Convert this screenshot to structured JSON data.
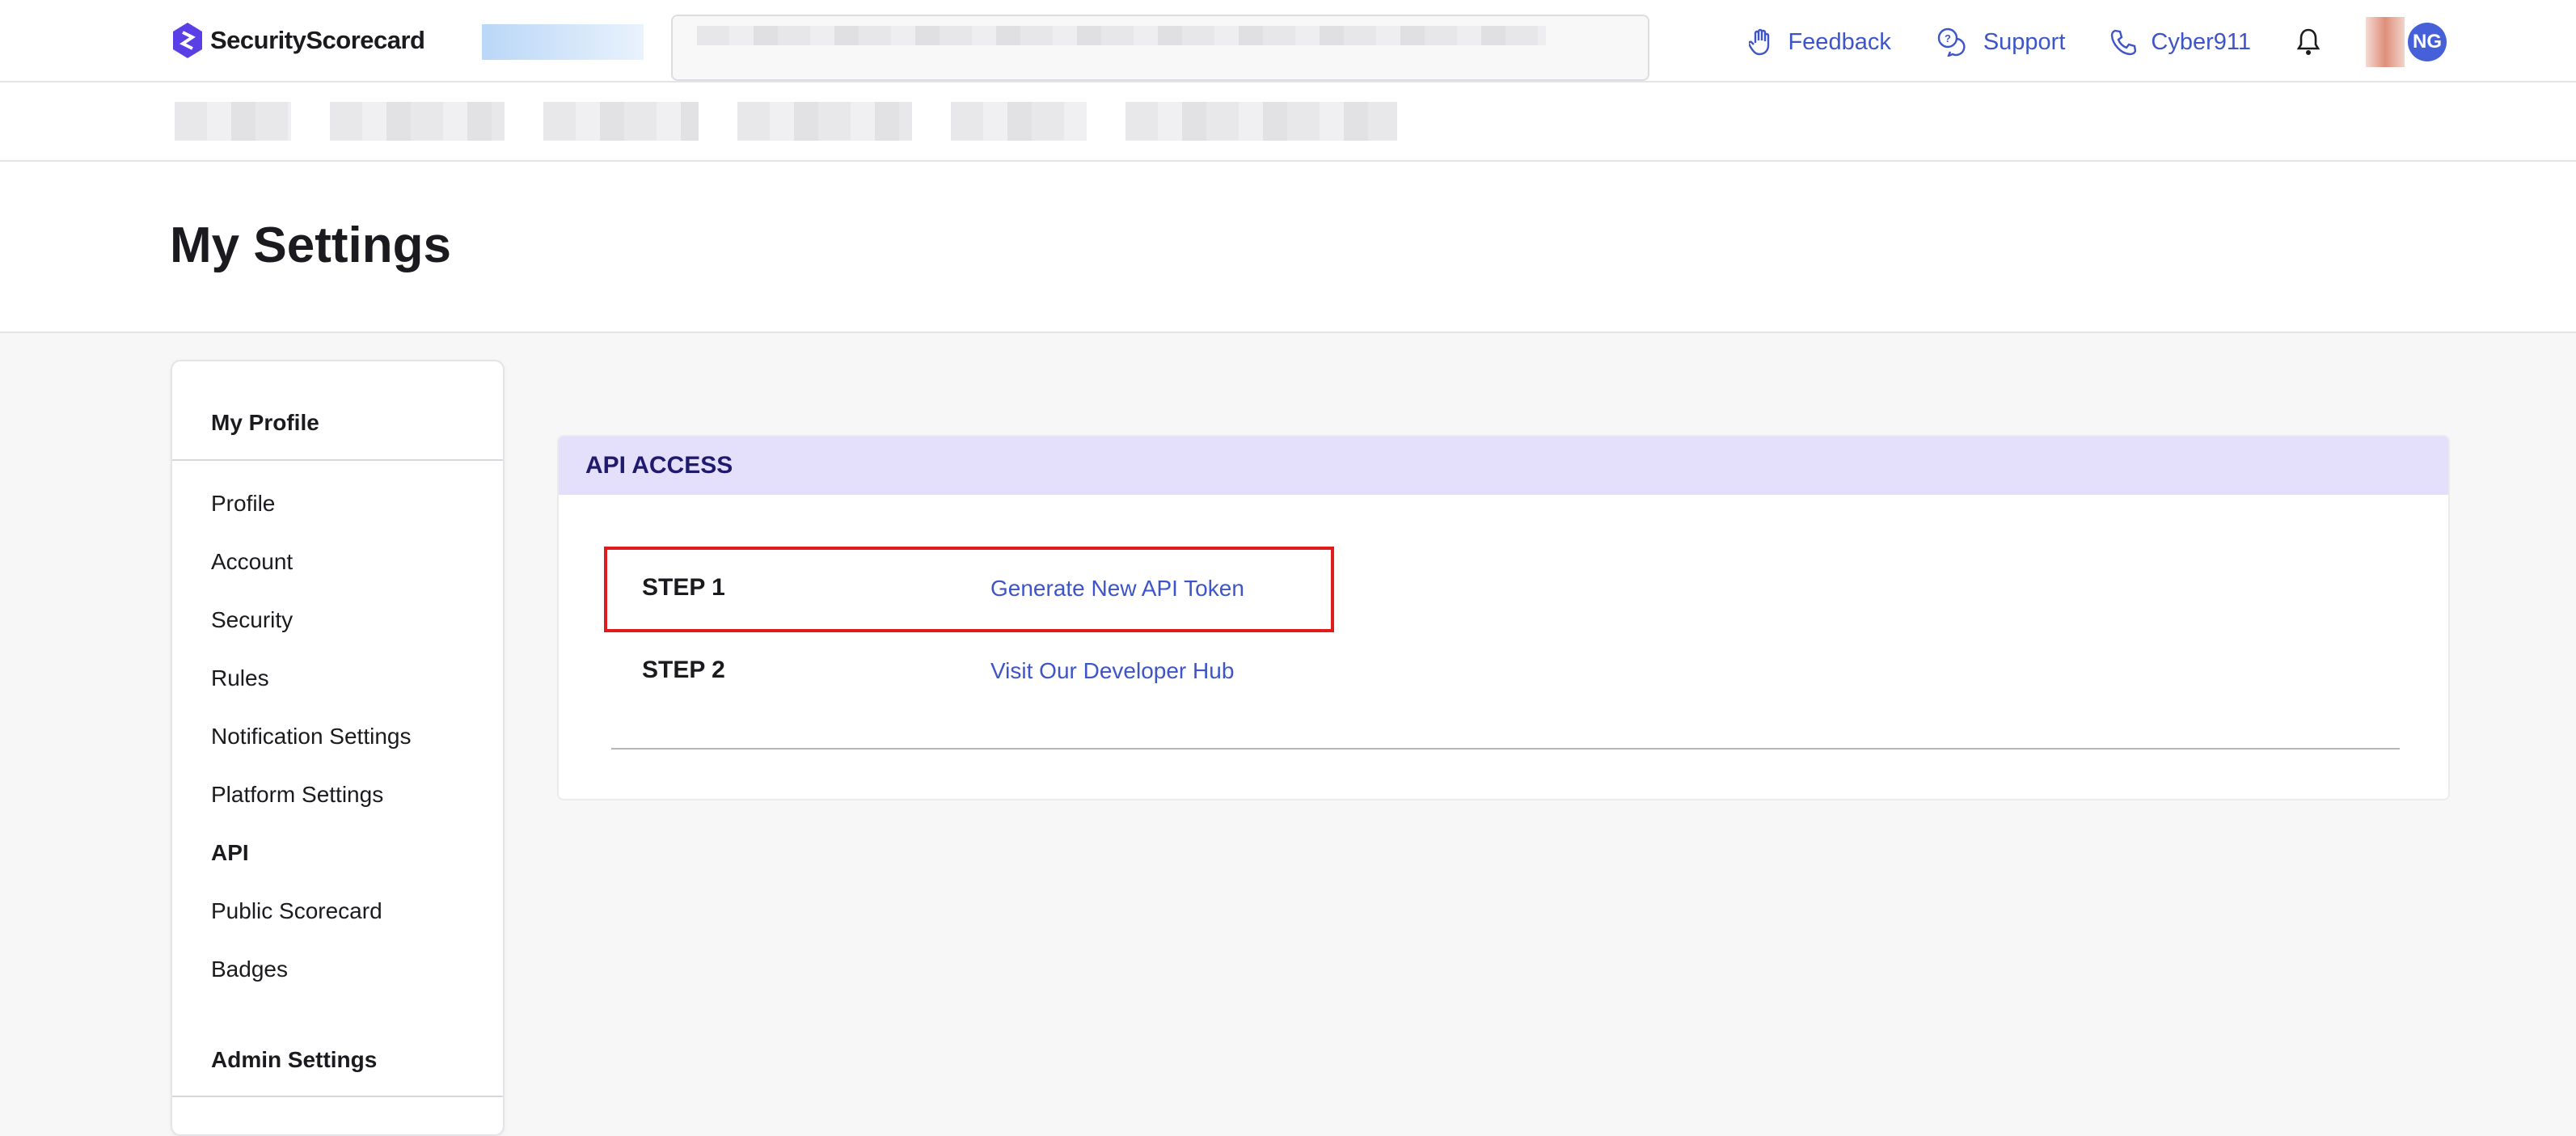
{
  "header": {
    "brand": "SecurityScorecard",
    "links": [
      {
        "label": "Feedback",
        "icon": "hand-icon"
      },
      {
        "label": "Support",
        "icon": "chat-question-icon"
      },
      {
        "label": "Cyber911",
        "icon": "phone-icon"
      }
    ],
    "avatar_initials": "NG",
    "accent": "#3d55c9"
  },
  "page": {
    "title": "My Settings"
  },
  "sidebar": {
    "section1": "My Profile",
    "items": [
      {
        "label": "Profile"
      },
      {
        "label": "Account"
      },
      {
        "label": "Security"
      },
      {
        "label": "Rules"
      },
      {
        "label": "Notification Settings"
      },
      {
        "label": "Platform Settings"
      },
      {
        "label": "API",
        "active": true
      },
      {
        "label": "Public Scorecard"
      },
      {
        "label": "Badges"
      }
    ],
    "section2": "Admin Settings"
  },
  "api": {
    "header": "API ACCESS",
    "header_color": "#e4e0fb",
    "steps": [
      {
        "label": "STEP 1",
        "link": "Generate New API Token"
      },
      {
        "label": "STEP 2",
        "link": "Visit Our Developer Hub"
      }
    ]
  }
}
